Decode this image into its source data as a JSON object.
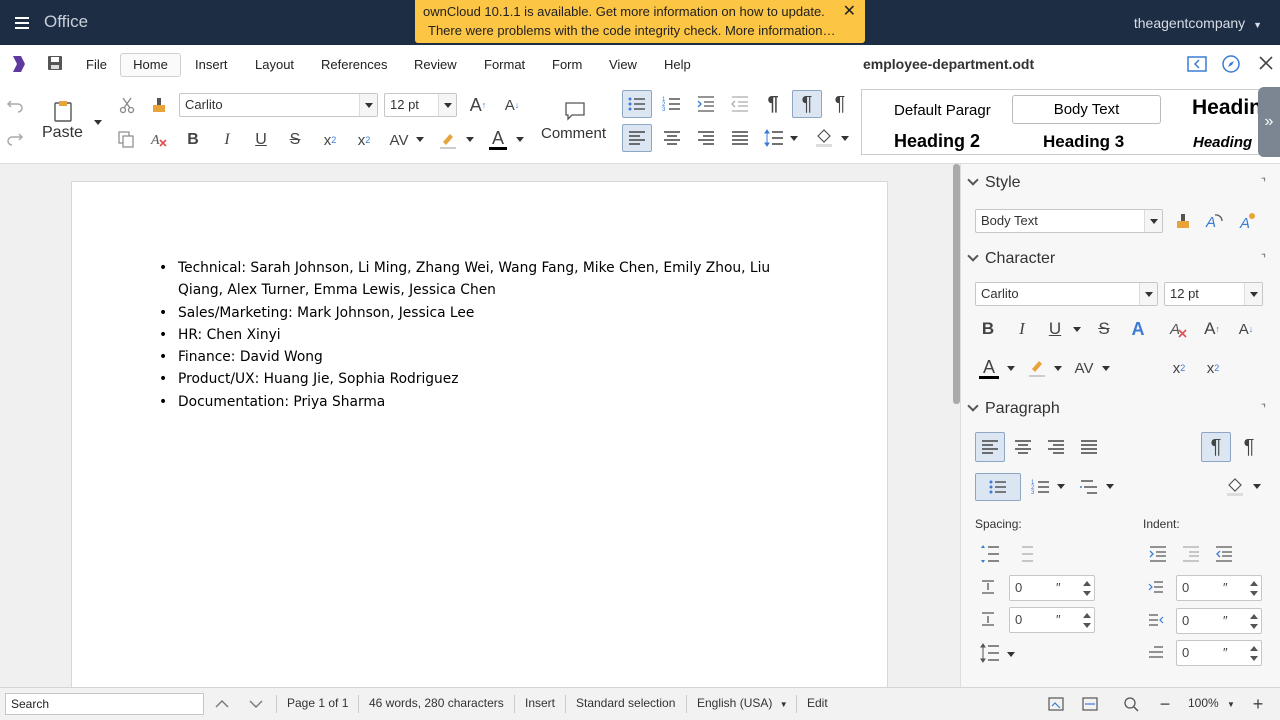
{
  "header": {
    "app_name": "Office",
    "user": "theagentcompany",
    "notification": {
      "line1": "ownCloud 10.1.1 is available. Get more information on how to update.",
      "line2": "There were problems with the code integrity check. More information…"
    }
  },
  "menubar": {
    "items": [
      "File",
      "Home",
      "Insert",
      "Layout",
      "References",
      "Review",
      "Format",
      "Form",
      "View",
      "Help"
    ],
    "active": "Home",
    "document_name": "employee-department.odt"
  },
  "toolbar": {
    "paste_label": "Paste",
    "comment_label": "Comment",
    "font_name": "Carlito",
    "font_size": "12 pt",
    "styles": [
      "Default Paragr",
      "Body Text",
      "Headin",
      "Heading 2",
      "Heading 3",
      "Heading"
    ]
  },
  "document": {
    "bullets": [
      "Technical: Sarah Johnson, Li Ming, Zhang Wei, Wang Fang, Mike Chen, Emily Zhou, Liu Qiang, Alex Turner, Emma Lewis, Jessica Chen",
      "Sales/Marketing: Mark Johnson, Jessica Lee",
      "HR: Chen Xinyi",
      "Finance: David Wong",
      "Product/UX: Huang Jie, Sophia Rodriguez",
      "Documentation: Priya Sharma"
    ]
  },
  "sidebar": {
    "style": {
      "title": "Style",
      "value": "Body Text"
    },
    "character": {
      "title": "Character",
      "font": "Carlito",
      "size": "12 pt"
    },
    "paragraph": {
      "title": "Paragraph",
      "spacing_label": "Spacing:",
      "indent_label": "Indent:",
      "values": [
        "0",
        "0",
        "0",
        "0",
        "0"
      ],
      "unit": "″"
    }
  },
  "statusbar": {
    "search_value": "Search",
    "page": "Page 1 of 1",
    "counts": "46 words, 280 characters",
    "mode": "Insert",
    "selection": "Standard selection",
    "language": "English (USA)",
    "edit": "Edit",
    "zoom": "100%"
  },
  "colors": {
    "header_bg": "#1d2d44",
    "notification_bg": "#fdc544",
    "accent": "#3a7bd5"
  }
}
